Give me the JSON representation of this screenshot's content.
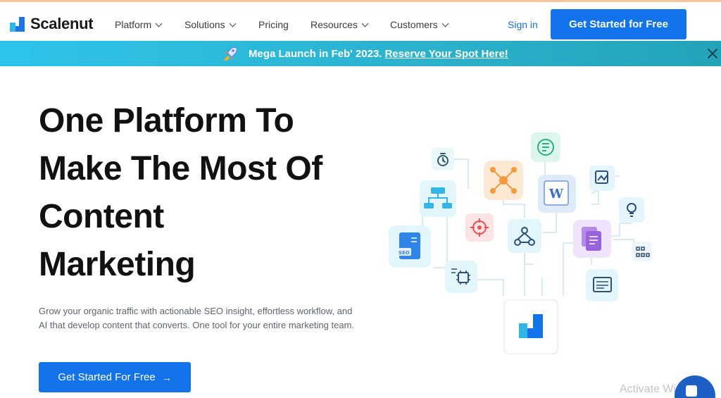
{
  "brand": {
    "name": "Scalenut"
  },
  "nav": {
    "items": [
      {
        "label": "Platform",
        "has_dropdown": true
      },
      {
        "label": "Solutions",
        "has_dropdown": true
      },
      {
        "label": "Pricing",
        "has_dropdown": false
      },
      {
        "label": "Resources",
        "has_dropdown": true
      },
      {
        "label": "Customers",
        "has_dropdown": true
      }
    ],
    "sign_in": "Sign in",
    "cta": "Get Started for Free"
  },
  "banner": {
    "icon": "rocket-icon",
    "text": "Mega Launch in Feb' 2023.",
    "link": "Reserve Your Spot Here!"
  },
  "hero": {
    "headline_lines": [
      "One Platform To",
      "Make The Most Of",
      "Content",
      "Marketing"
    ],
    "description": "Grow your organic traffic with actionable SEO insight, effortless workflow, and AI that develop content that converts. One tool for your entire marketing team.",
    "cta": "Get Started For Free",
    "cta_arrow": "→"
  },
  "overlay": {
    "watermark": "Activate Windows"
  },
  "colors": {
    "primary": "#1273eb",
    "banner": "#2bb3cf",
    "accent_cyan": "#32b6e6"
  }
}
